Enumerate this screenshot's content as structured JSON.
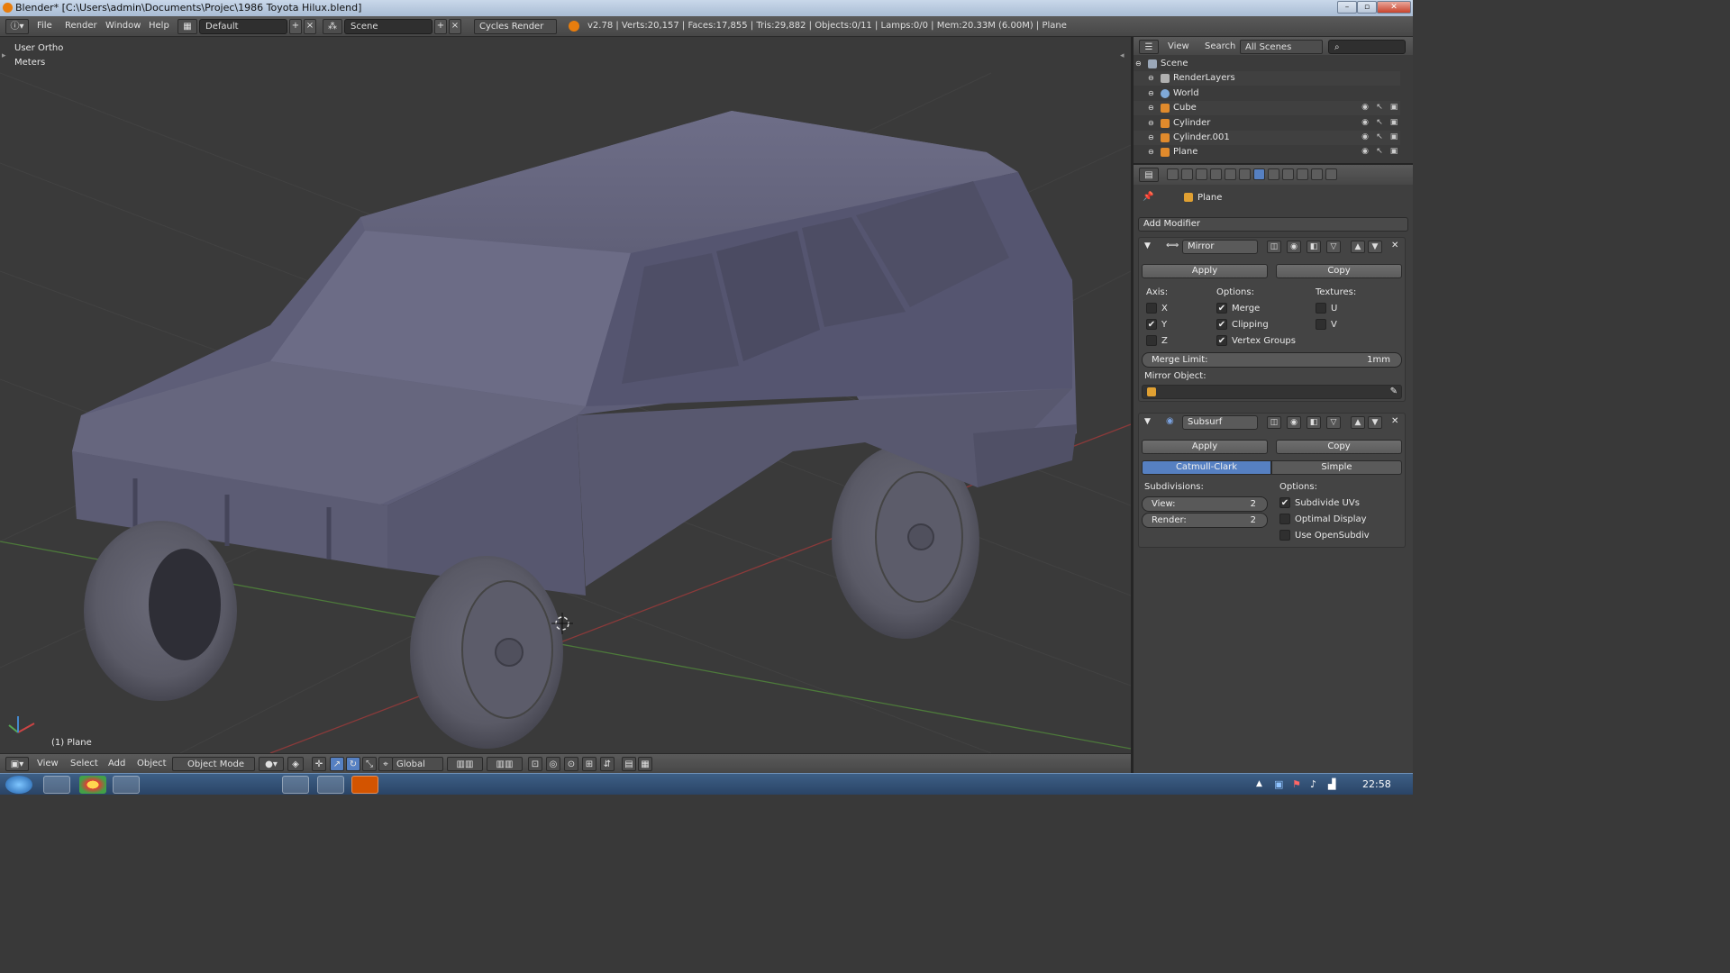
{
  "window": {
    "title": "Blender* [C:\\Users\\admin\\Documents\\Projec\\1986 Toyota Hilux.blend]",
    "controls": [
      "–",
      "▫",
      "✕"
    ]
  },
  "infobar": {
    "menus": [
      "File",
      "Render",
      "Window",
      "Help"
    ],
    "screen_layout": "Default",
    "scene": "Scene",
    "render_engine": "Cycles Render",
    "stats": "v2.78 | Verts:20,157 | Faces:17,855 | Tris:29,882 | Objects:0/11 | Lamps:0/0 | Mem:20.33M (6.00M) | Plane"
  },
  "viewport": {
    "view_name": "User Ortho",
    "units": "Meters",
    "active_object": "(1) Plane"
  },
  "view3d_header": {
    "menus": [
      "View",
      "Select",
      "Add",
      "Object"
    ],
    "mode": "Object Mode",
    "orientation": "Global"
  },
  "outliner": {
    "menus": [
      "View",
      "Search"
    ],
    "filter": "All Scenes",
    "items": [
      {
        "label": "Scene",
        "icon": "scene-icon",
        "indent": 0,
        "visibility": false
      },
      {
        "label": "RenderLayers",
        "icon": "render-layers-icon",
        "indent": 1,
        "visibility": false
      },
      {
        "label": "World",
        "icon": "world-icon",
        "indent": 1,
        "visibility": false
      },
      {
        "label": "Cube",
        "icon": "mesh-icon",
        "indent": 1,
        "visibility": true
      },
      {
        "label": "Cylinder",
        "icon": "mesh-icon",
        "indent": 1,
        "visibility": true
      },
      {
        "label": "Cylinder.001",
        "icon": "mesh-icon",
        "indent": 1,
        "visibility": true
      },
      {
        "label": "Plane",
        "icon": "mesh-icon",
        "indent": 1,
        "visibility": true
      }
    ]
  },
  "properties": {
    "context_object": "Plane",
    "add_modifier": "Add Modifier",
    "mirror": {
      "name": "Mirror",
      "apply": "Apply",
      "copy": "Copy",
      "axis_label": "Axis:",
      "options_label": "Options:",
      "textures_label": "Textures:",
      "axes": [
        {
          "label": "X",
          "checked": false
        },
        {
          "label": "Y",
          "checked": true
        },
        {
          "label": "Z",
          "checked": false
        }
      ],
      "options": [
        {
          "label": "Merge",
          "checked": true
        },
        {
          "label": "Clipping",
          "checked": true
        },
        {
          "label": "Vertex Groups",
          "checked": true
        }
      ],
      "textures": [
        {
          "label": "U",
          "checked": false
        },
        {
          "label": "V",
          "checked": false
        }
      ],
      "merge_limit_label": "Merge Limit:",
      "merge_limit_value": "1mm",
      "mirror_object_label": "Mirror Object:"
    },
    "subsurf": {
      "name": "Subsurf",
      "apply": "Apply",
      "copy": "Copy",
      "algorithms": [
        "Catmull-Clark",
        "Simple"
      ],
      "active_algorithm": "Catmull-Clark",
      "subdivisions_label": "Subdivisions:",
      "view_label": "View:",
      "view_value": "2",
      "render_label": "Render:",
      "render_value": "2",
      "options_label": "Options:",
      "options": [
        {
          "label": "Subdivide UVs",
          "checked": true
        },
        {
          "label": "Optimal Display",
          "checked": false
        },
        {
          "label": "Use OpenSubdiv",
          "checked": false
        }
      ]
    }
  },
  "taskbar": {
    "clock": "22:58"
  },
  "colors": {
    "accent": "#5680c2",
    "viewport_bg": "#3a3a3a",
    "grid_x": "#8b3a3a",
    "grid_y": "#4d7a3a",
    "car_body": "#5d5d78"
  }
}
